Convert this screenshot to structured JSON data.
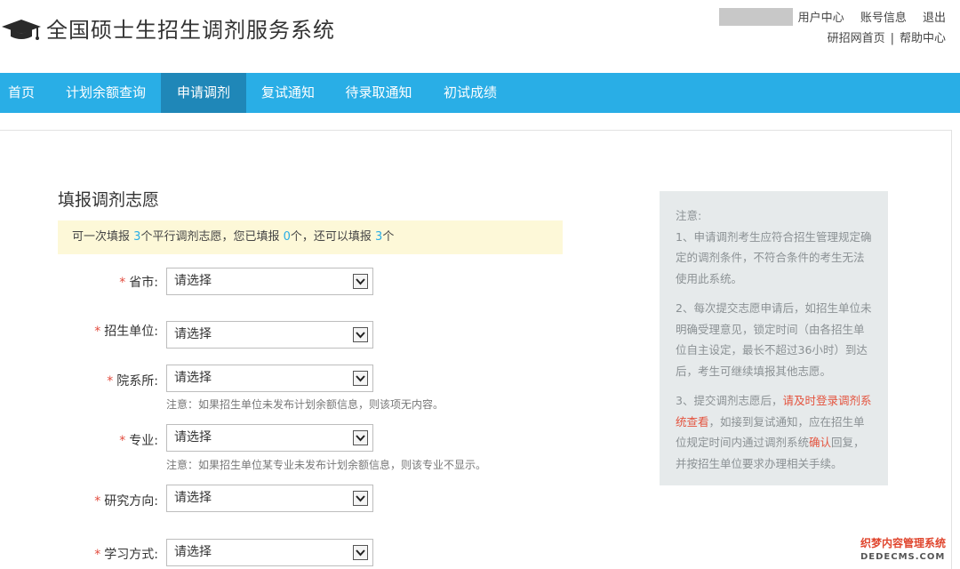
{
  "header": {
    "site_title": "全国硕士生招生调剂服务系统",
    "top_links": [
      "用户中心",
      "账号信息",
      "退出"
    ],
    "sub_links": [
      "研招网首页",
      "帮助中心"
    ],
    "separator": "|"
  },
  "nav": {
    "items": [
      "首页",
      "计划余额查询",
      "申请调剂",
      "复试通知",
      "待录取通知",
      "初试成绩"
    ],
    "active": "申请调剂"
  },
  "main": {
    "section_title": "填报调剂志愿",
    "quota": {
      "part1": "可一次填报",
      "total": "3",
      "part2": "个平行调剂志愿，您已填报",
      "filled": "0",
      "part3": "个，还可以填报",
      "remaining": "3",
      "part4": "个"
    },
    "form": {
      "required_mark": "*",
      "fields": [
        {
          "label": "省市:",
          "value": "请选择",
          "hint": ""
        },
        {
          "label": "招生单位:",
          "value": "请选择",
          "hint": ""
        },
        {
          "label": "院系所:",
          "value": "请选择",
          "hint": "注意：如果招生单位未发布计划余额信息，则该项无内容。"
        },
        {
          "label": "专业:",
          "value": "请选择",
          "hint": "注意：如果招生单位某专业未发布计划余额信息，则该专业不显示。"
        },
        {
          "label": "研究方向:",
          "value": "请选择",
          "hint": ""
        },
        {
          "label": "学习方式:",
          "value": "请选择",
          "hint": ""
        }
      ]
    }
  },
  "notice": {
    "title": "注意:",
    "p1": "1、申请调剂考生应符合招生管理规定确定的调剂条件，不符合条件的考生无法使用此系统。",
    "p2": "2、每次提交志愿申请后，如招生单位未明确受理意见，锁定时间（由各招生单位自主设定，最长不超过36小时）到达后，考生可继续填报其他志愿。",
    "p3_a": "3、提交调剂志愿后，",
    "p3_red1": "请及时登录调剂系统查看",
    "p3_b": "，如接到复试通知，应在招生单位规定时间内通过调剂系统",
    "p3_red2": "确认",
    "p3_c": "回复，并按招生单位要求办理相关手续。"
  },
  "watermark": {
    "line1": "织梦内容管理系统",
    "line2": "DEDECMS.COM"
  },
  "colors": {
    "nav_bg": "#29aee6",
    "nav_active": "#1f87b8",
    "required": "#e24a3d",
    "accent_number": "#29aee6",
    "notice_red": "#e4543f"
  }
}
